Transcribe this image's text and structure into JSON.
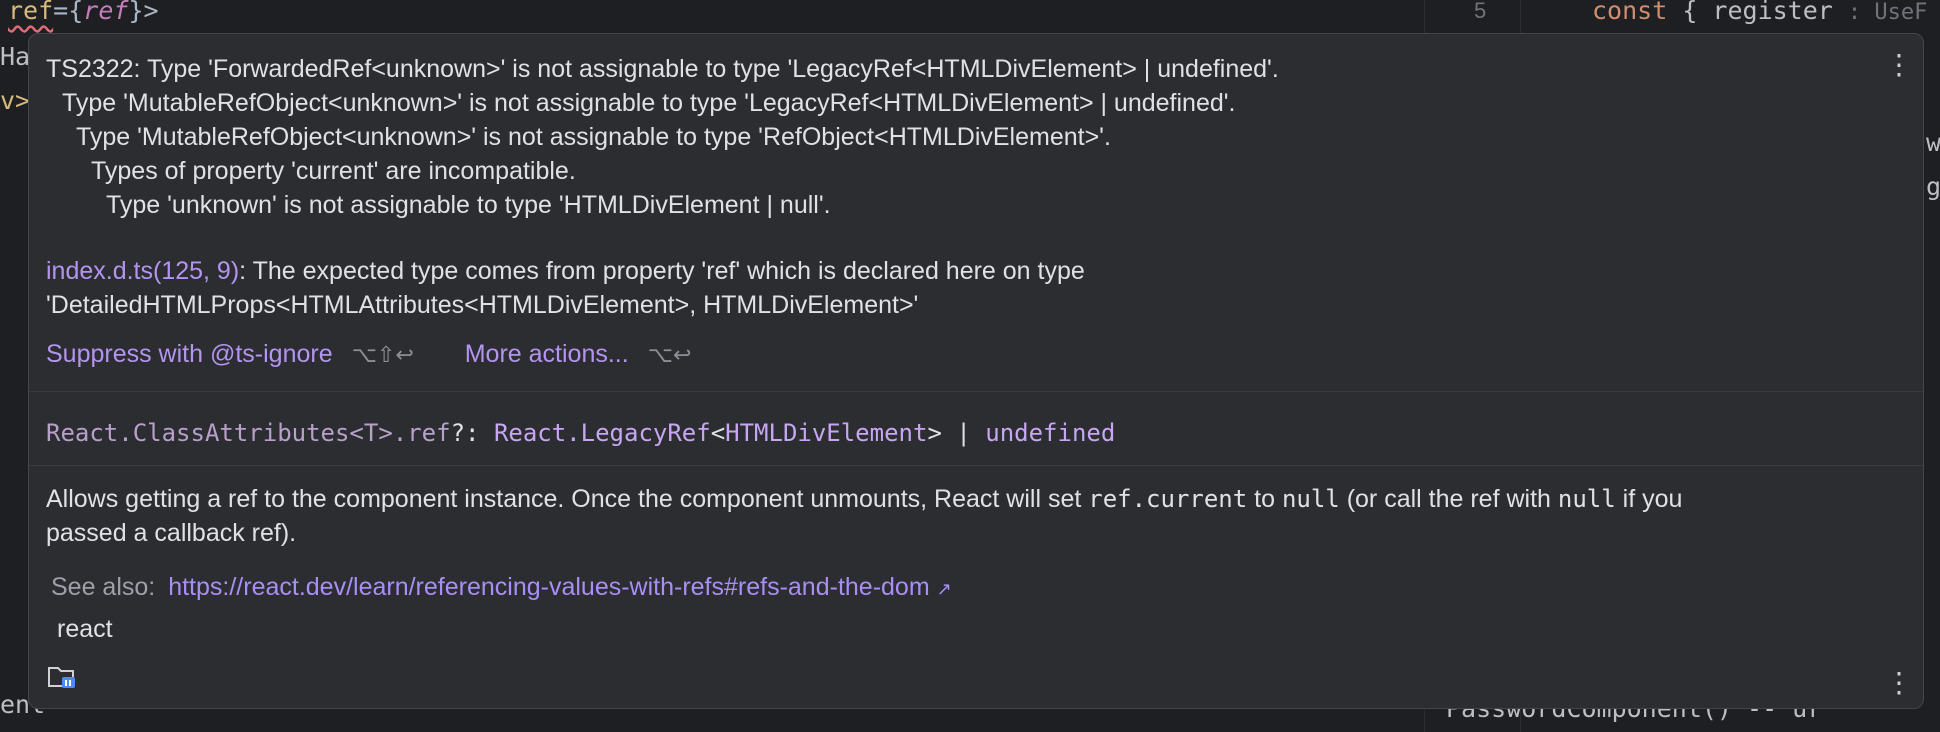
{
  "editor": {
    "top_left_code_parts": [
      "ref",
      "=",
      "{",
      "ref",
      "}>"
    ],
    "left_fragment_1": "Ha",
    "left_fragment_2": "v>",
    "left_fragment_bottom": "ent",
    "gutter_line_number": "5",
    "right_code_kw": "const",
    "right_code_rest": "{ register",
    "right_code_hint": ": UseF",
    "right_frag_1": "w",
    "right_frag_2": "g",
    "right_bottom_fragment": "PasswordComponent() -- ur"
  },
  "popup": {
    "error_lines": [
      "TS2322: Type 'ForwardedRef<unknown>' is not assignable to type 'LegacyRef<HTMLDivElement> | undefined'.",
      "Type 'MutableRefObject<unknown>' is not assignable to type 'LegacyRef<HTMLDivElement> | undefined'.",
      "Type 'MutableRefObject<unknown>' is not assignable to type 'RefObject<HTMLDivElement>'.",
      "Types of property 'current' are incompatible.",
      "Type 'unknown' is not assignable to type 'HTMLDivElement | null'."
    ],
    "source_link": "index.d.ts(125, 9)",
    "source_text_1": ": The expected type comes from property 'ref' which is declared here on type",
    "source_text_2": "'DetailedHTMLProps<HTMLAttributes<HTMLDivElement>, HTMLDivElement>'",
    "actions": {
      "suppress_label": "Suppress with @ts-ignore",
      "suppress_shortcut": "⌥⇧↩",
      "more_label": "More actions...",
      "more_shortcut": "⌥↩"
    },
    "signature": {
      "owner": "React.ClassAttributes<T>.ref",
      "optional": "?",
      "colon": ": ",
      "type_ns": "React.",
      "type_name": "LegacyRef",
      "type_param_open": "<",
      "type_param": "HTMLDivElement",
      "type_param_close": ">",
      "union": " | ",
      "undefined": "undefined"
    },
    "doc": {
      "line1_a": "Allows getting a ref to the component instance. Once the component unmounts, React will set ",
      "code1": "ref.current",
      "line1_b": " to ",
      "code2": "null",
      "line1_c": " (or call the ref with ",
      "code3": "null",
      "line1_d": " if you",
      "line2": "passed a callback ref)."
    },
    "see_also_label": "See also:",
    "see_also_url": "https://react.dev/learn/referencing-values-with-refs#refs-and-the-dom",
    "see_also_arrow": "↗",
    "library": "react",
    "icons": {
      "kebab_top": "more-vertical-icon",
      "kebab_bottom": "more-vertical-icon",
      "library_folder": "library-folder-icon"
    }
  }
}
